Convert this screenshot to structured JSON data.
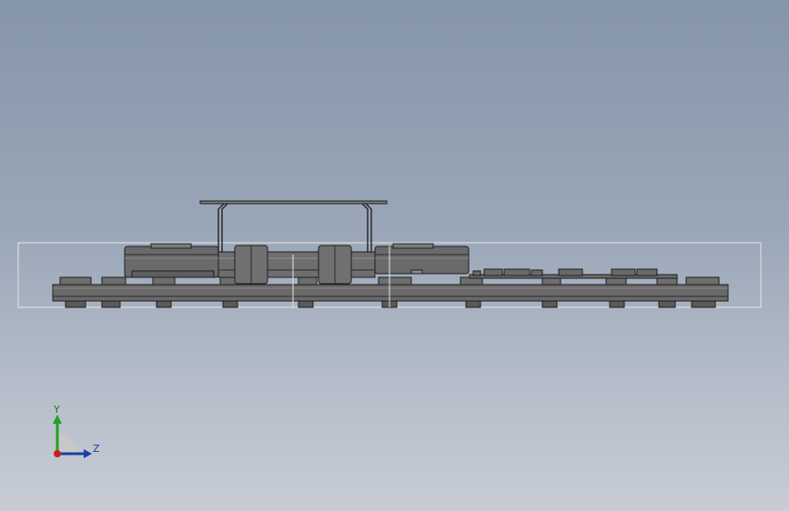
{
  "viewport": {
    "background_top": "#8595aa",
    "background_bottom": "#c7ccd5"
  },
  "model": {
    "body_color": "#6a6a6a",
    "edge_color": "#1e1e1e",
    "highlight_color": "#8a8a8a",
    "bounding_box_color": "#e6e6e6"
  },
  "triad": {
    "y_axis_label": "Y",
    "z_axis_label": "Z",
    "y_axis_color": "#22a022",
    "z_axis_color": "#1a3fa6",
    "x_axis_color": "#c81e1e",
    "plane_color": "#c8c8c8"
  }
}
